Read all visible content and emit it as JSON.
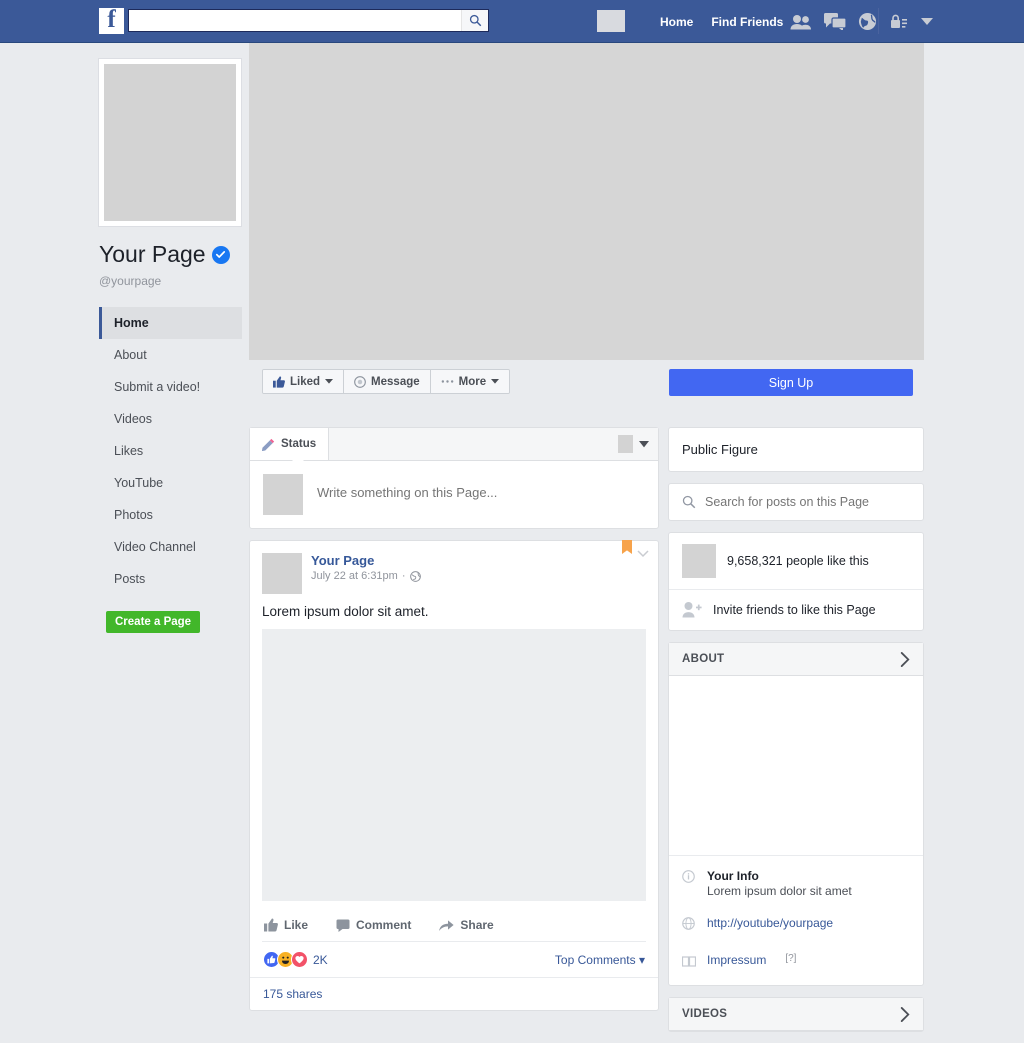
{
  "topbar": {
    "logo": "f",
    "search_value": "",
    "search_placeholder": "",
    "search_icon": "search-icon",
    "links": [
      {
        "label": "Home"
      },
      {
        "label": "Find Friends"
      }
    ],
    "icons": [
      {
        "name": "friend-requests-icon"
      },
      {
        "name": "messages-icon"
      },
      {
        "name": "notifications-globe-icon"
      },
      {
        "name": "privacy-lock-icon"
      },
      {
        "name": "account-dropdown-caret-icon"
      }
    ],
    "brand_color": "#3b5998"
  },
  "page": {
    "title": "Your Page",
    "verified": true,
    "handle": "@yourpage"
  },
  "sidebar": {
    "items": [
      {
        "label": "Home",
        "active": true
      },
      {
        "label": "About",
        "active": false
      },
      {
        "label": "Submit a video!",
        "active": false
      },
      {
        "label": "Videos",
        "active": false
      },
      {
        "label": "Likes",
        "active": false
      },
      {
        "label": "YouTube",
        "active": false
      },
      {
        "label": "Photos",
        "active": false
      },
      {
        "label": "Video Channel",
        "active": false
      },
      {
        "label": "Posts",
        "active": false
      }
    ],
    "create_page_label": "Create a Page",
    "create_page_color": "#42b72a"
  },
  "actionbar": {
    "liked_label": "Liked",
    "message_label": "Message",
    "more_label": "More",
    "signup_label": "Sign Up",
    "signup_color": "#4267f2"
  },
  "composer": {
    "tab_label": "Status",
    "placeholder": "Write something on this Page..."
  },
  "post": {
    "author": "Your Page",
    "timestamp": "July 22 at 6:31pm",
    "privacy_icon": "globe-icon",
    "text": "Lorem ipsum dolor sit amet.",
    "like_label": "Like",
    "comment_label": "Comment",
    "share_label": "Share",
    "reactions": [
      {
        "name": "like-reaction",
        "color": "#4267f2",
        "glyph": "\u0001"
      },
      {
        "name": "haha-reaction",
        "color": "#f7b125",
        "glyph": "\u0001"
      },
      {
        "name": "love-reaction",
        "color": "#f25268",
        "glyph": "\u0001"
      }
    ],
    "reaction_count": "2K",
    "top_comments_label": "Top Comments",
    "shares": "175 shares",
    "pin_icon": "bookmark-pin-icon"
  },
  "rightcol": {
    "category": "Public Figure",
    "search_placeholder": "Search for posts on this Page",
    "likes_text": "9,658,321 people like this",
    "invite_text": "Invite friends to like this Page",
    "about_heading": "ABOUT",
    "videos_heading": "VIDEOS",
    "about_rows": [
      {
        "icon": "info-icon",
        "label": "Your Info",
        "sub": "Lorem ipsum dolor sit amet"
      },
      {
        "icon": "globe-icon",
        "link": "http://youtube/yourpage"
      },
      {
        "icon": "book-icon",
        "link": "Impressum",
        "note": "[?]"
      }
    ]
  }
}
